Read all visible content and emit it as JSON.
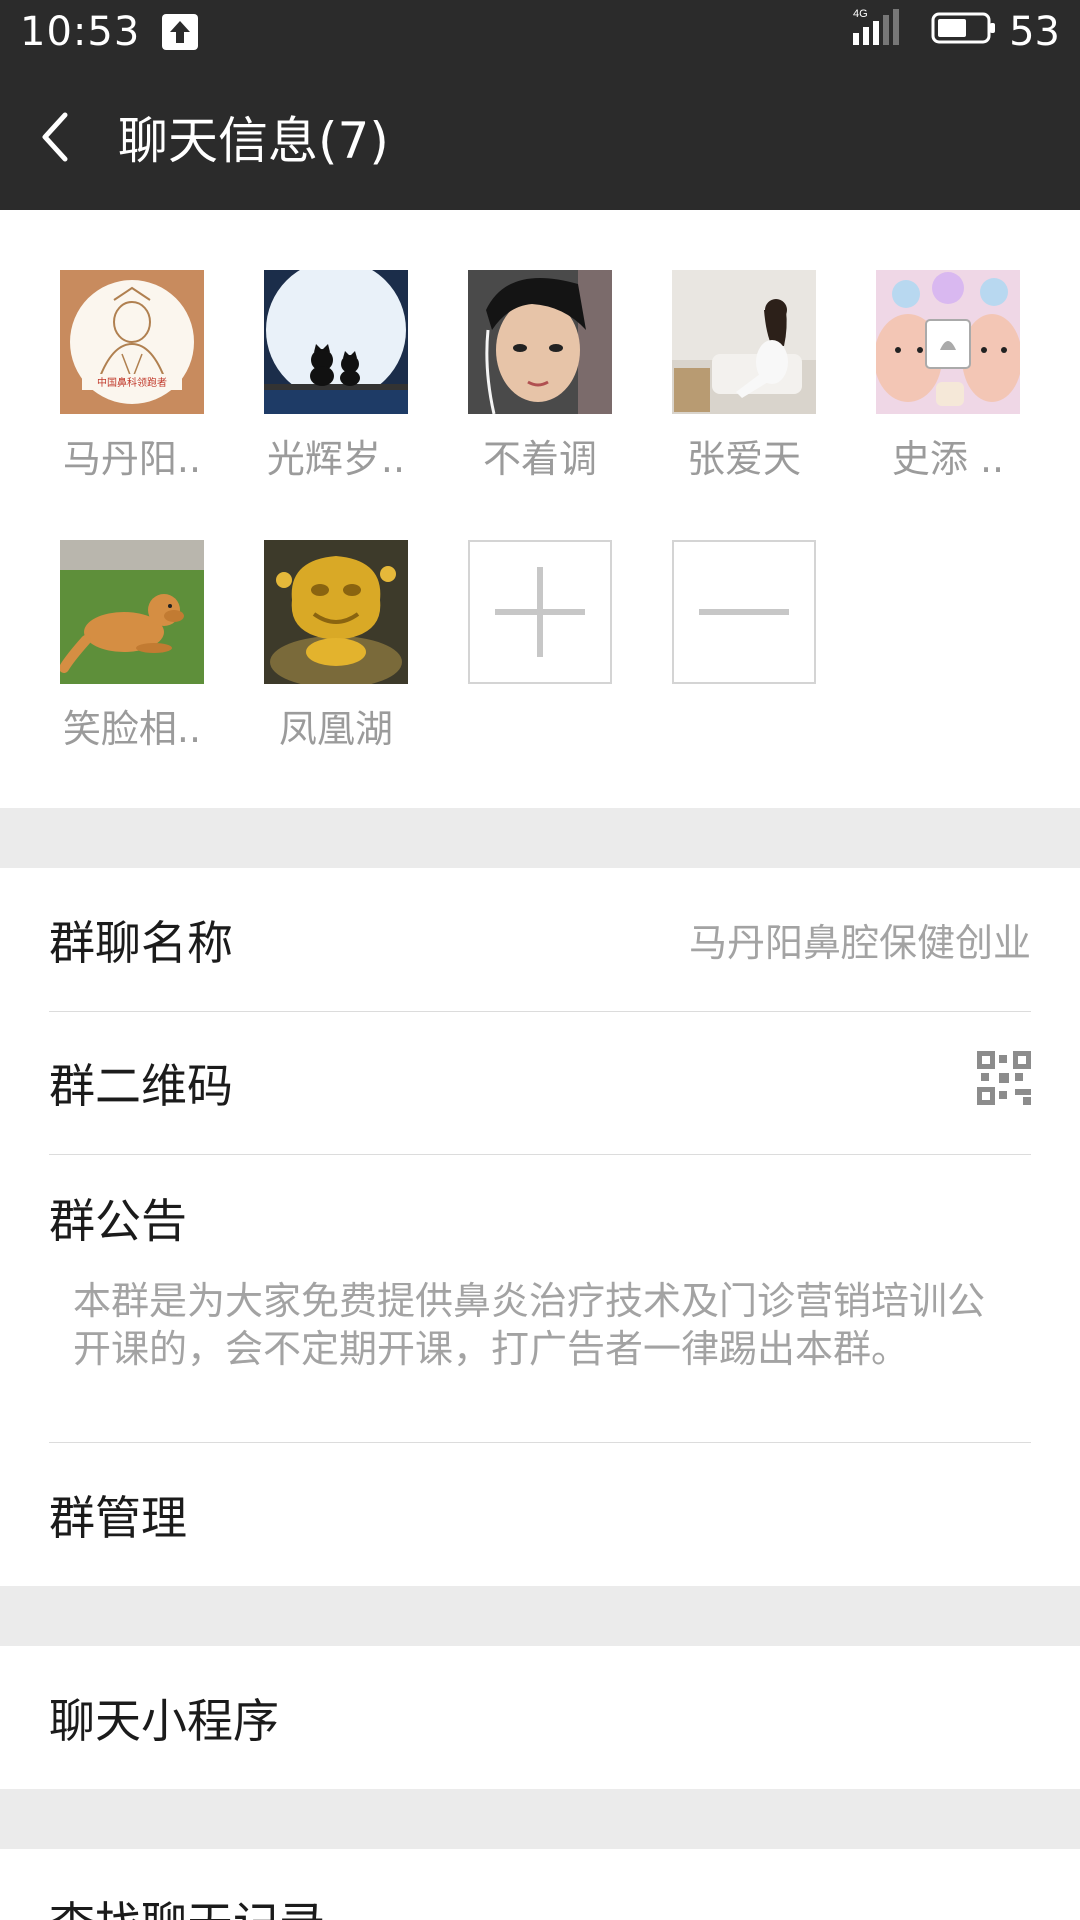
{
  "status_bar": {
    "time": "10:53",
    "network": "4G",
    "battery": "53"
  },
  "header": {
    "title": "聊天信息(7)"
  },
  "members": [
    {
      "name": "马丹阳..",
      "avatar": "doctor-portrait"
    },
    {
      "name": "光辉岁..",
      "avatar": "moon-cats"
    },
    {
      "name": "不着调",
      "avatar": "boy-earphones"
    },
    {
      "name": "张爱天",
      "avatar": "woman-sofa"
    },
    {
      "name": "史添  ..",
      "avatar": "babies"
    },
    {
      "name": "笑脸相..",
      "avatar": "golden-dog"
    },
    {
      "name": "凤凰湖",
      "avatar": "golden-statue"
    }
  ],
  "avatar_caption": "中国鼻科领跑者",
  "settings": {
    "group_name_label": "群聊名称",
    "group_name_value": "马丹阳鼻腔保健创业",
    "qr_label": "群二维码",
    "notice_label": "群公告",
    "notice_text": "本群是为大家免费提供鼻炎治疗技术及门诊营销培训公开课的，会不定期开课，打广告者一律踢出本群。",
    "manage_label": "群管理",
    "mini_program_label": "聊天小程序",
    "search_history_label": "查找聊天记录"
  }
}
